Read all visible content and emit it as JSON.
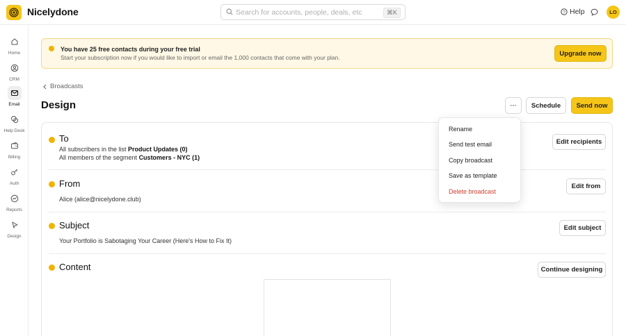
{
  "app": {
    "name": "Nicelydone"
  },
  "search": {
    "placeholder": "Search for accounts, people, deals, etc",
    "shortcut": "⌘K"
  },
  "header": {
    "help_label": "Help",
    "avatar_initials": "LO"
  },
  "sidebar": {
    "items": [
      {
        "label": "Home",
        "icon": "home-icon",
        "active": false
      },
      {
        "label": "CRM",
        "icon": "contacts-icon",
        "active": false
      },
      {
        "label": "Email",
        "icon": "mail-icon",
        "active": true
      },
      {
        "label": "Help Desk",
        "icon": "chat-bubbles-icon",
        "active": false
      },
      {
        "label": "Billing",
        "icon": "wallet-icon",
        "active": false
      },
      {
        "label": "Auth",
        "icon": "key-icon",
        "active": false
      },
      {
        "label": "Reports",
        "icon": "chart-icon",
        "active": false
      },
      {
        "label": "Design",
        "icon": "pen-tool-icon",
        "active": false
      }
    ]
  },
  "trial_banner": {
    "title": "You have 25 free contacts during your free trial",
    "message": "Start your subscription now if you would like to import or email the 1,000 contacts that come with your plan.",
    "upgrade_label": "Upgrade now"
  },
  "breadcrumb": {
    "label": "Broadcasts"
  },
  "page": {
    "title": "Design"
  },
  "toolbar": {
    "more_label": "···",
    "schedule_label": "Schedule",
    "send_label": "Send now"
  },
  "sections": {
    "to": {
      "heading": "To",
      "line1_prefix": "All subscribers in the list ",
      "line1_value": "Product Updates (0)",
      "line2_prefix": "All members of the segment ",
      "line2_value": "Customers - NYC (1)",
      "button": "Edit recipients"
    },
    "from": {
      "heading": "From",
      "value": "Alice (alice@nicelydone.club)",
      "button": "Edit from"
    },
    "subject": {
      "heading": "Subject",
      "value": "Your Portfolio is Sabotaging Your Career (Here's How to Fix It)",
      "button": "Edit subject"
    },
    "content": {
      "heading": "Content",
      "button": "Continue designing"
    }
  },
  "dropdown": {
    "items": [
      "Rename",
      "Send test email",
      "Copy broadcast",
      "Save as template",
      "Delete broadcast"
    ]
  },
  "colors": {
    "accent": "#f5c518",
    "danger": "#d23c2c",
    "banner_bg": "#fff8e6"
  }
}
